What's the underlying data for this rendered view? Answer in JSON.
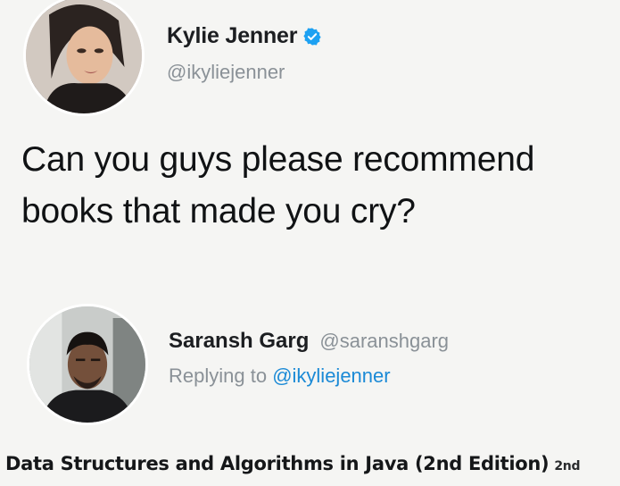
{
  "tweet": {
    "author_name": "Kylie Jenner",
    "author_handle": "@ikyliejenner",
    "verified_icon": "verified-badge-icon",
    "text": "Can you guys please recommend books that made you cry?"
  },
  "reply": {
    "author_name": "Saransh Garg",
    "author_handle": "@saranshgarg",
    "replying_to_label": "Replying to",
    "replying_to_handle": "@ikyliejenner",
    "text": "Data Structures and Algorithms in Java (2nd Edition)",
    "text_suffix": "2nd"
  },
  "colors": {
    "background": "#f5f5f3",
    "text": "#101214",
    "muted": "#8a9197",
    "link": "#1b8ad6",
    "verified": "#1da1f2"
  }
}
